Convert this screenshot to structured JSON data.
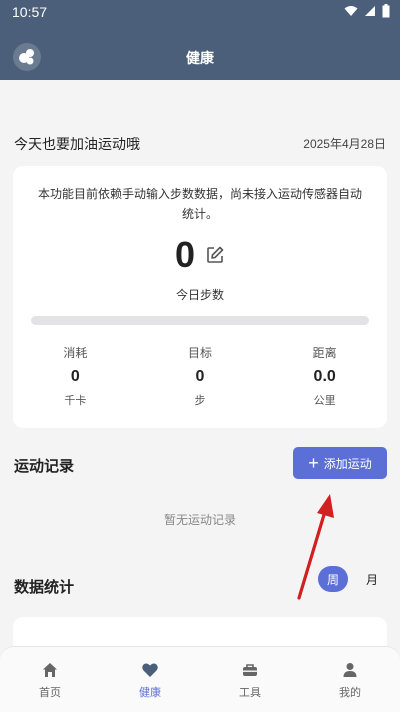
{
  "status_bar": {
    "time": "10:57"
  },
  "app_bar": {
    "title": "健康"
  },
  "greeting": "今天也要加油运动哦",
  "date": "2025年4月28日",
  "steps_card": {
    "notice": "本功能目前依赖手动输入步数数据，尚未接入运动传感器自动统计。",
    "steps_value": "0",
    "steps_label": "今日步数",
    "progress": 0,
    "stats": [
      {
        "label": "消耗",
        "value": "0",
        "unit": "千卡"
      },
      {
        "label": "目标",
        "value": "0",
        "unit": "步"
      },
      {
        "label": "距离",
        "value": "0.0",
        "unit": "公里"
      }
    ]
  },
  "records": {
    "title": "运动记录",
    "add_button_label": "添加运动",
    "empty_text": "暂无运动记录"
  },
  "statistics": {
    "title": "数据统计",
    "toggle_week": "周",
    "toggle_month": "月"
  },
  "bottom_nav": [
    {
      "label": "首页",
      "icon": "home-icon"
    },
    {
      "label": "健康",
      "icon": "heart-icon",
      "active": true
    },
    {
      "label": "工具",
      "icon": "toolbox-icon"
    },
    {
      "label": "我的",
      "icon": "person-icon"
    }
  ],
  "colors": {
    "header": "#4b5f7a",
    "accent": "#5b6fd6",
    "background": "#f4f4f5",
    "annotation_arrow": "#d21f1f"
  }
}
